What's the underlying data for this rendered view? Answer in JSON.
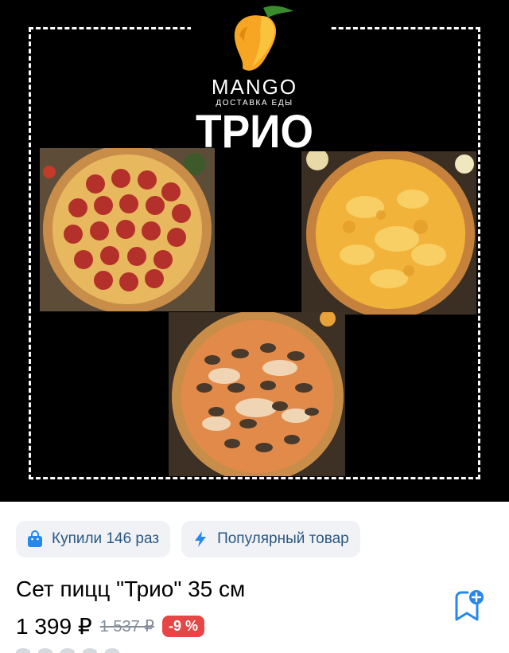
{
  "product_image": {
    "brand_name": "MANGO",
    "brand_subtitle": "ДОСТАВКА ЕДЫ",
    "set_title": "ТРИО",
    "pizzas": [
      "pepperoni",
      "four-cheese",
      "mushroom"
    ]
  },
  "badges": [
    {
      "icon": "shopping-bag-icon",
      "label": "Купили 146 раз"
    },
    {
      "icon": "lightning-icon",
      "label": "Популярный товар"
    }
  ],
  "product": {
    "title": "Сет пицц \"Трио\" 35 см",
    "price": "1 399 ₽",
    "old_price": "1 537 ₽",
    "discount": "-9 %"
  },
  "colors": {
    "accent_text": "#2a5885",
    "badge_bg": "#f0f2f5",
    "discount_bg": "#e64646",
    "icon_blue": "#2688eb"
  }
}
